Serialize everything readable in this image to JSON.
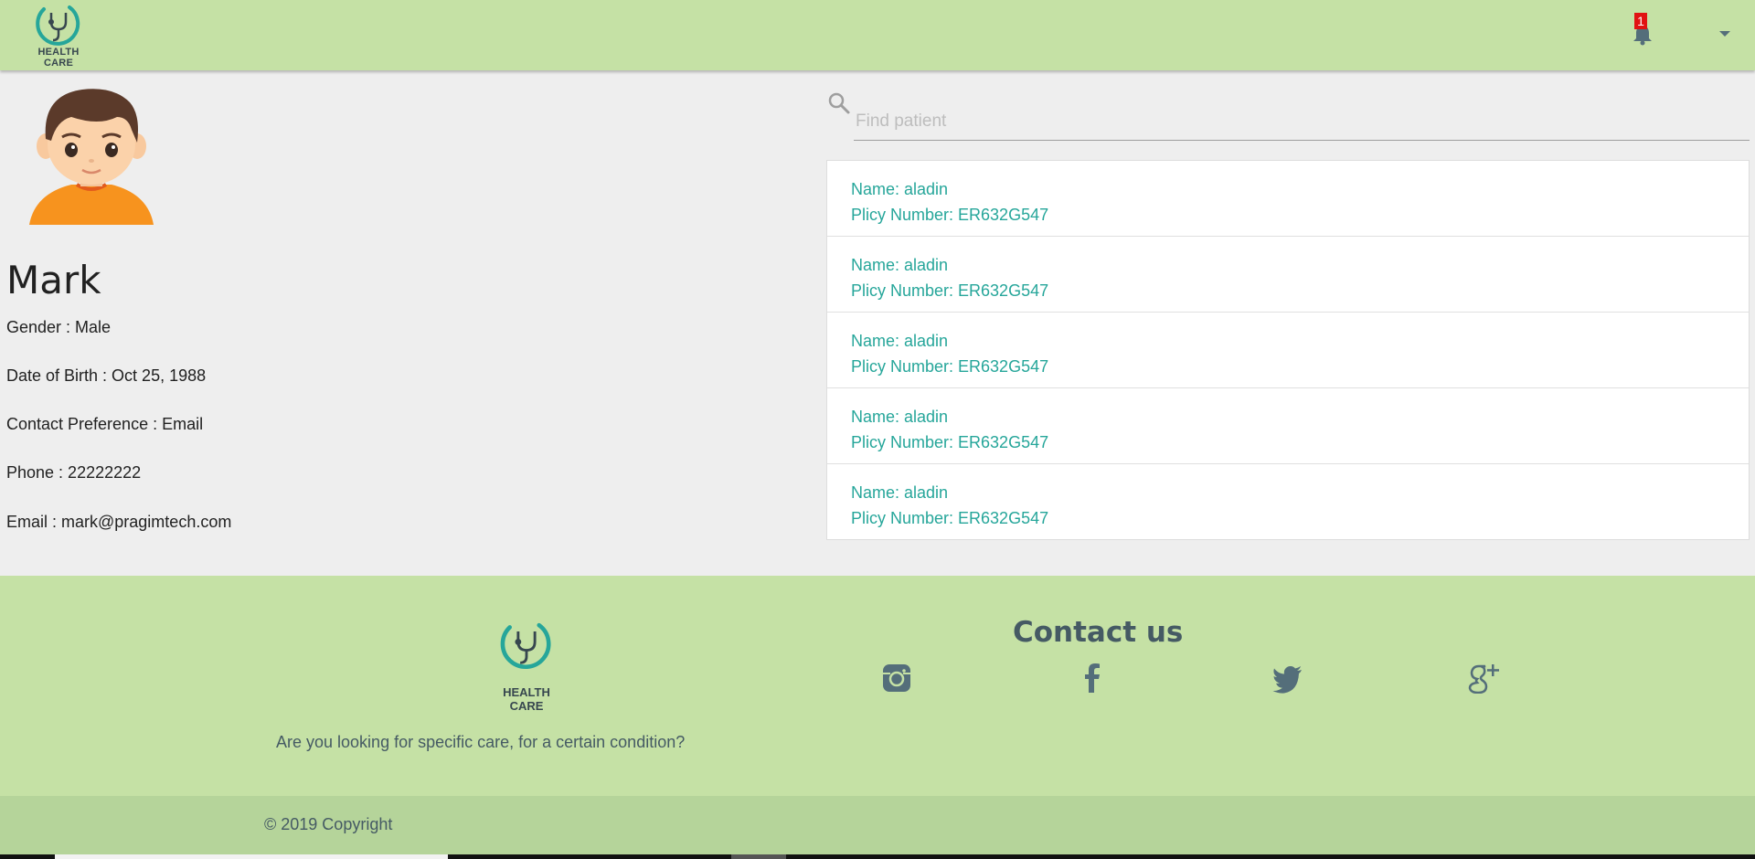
{
  "header": {
    "brand_name": "HEALTH CARE",
    "notification_count": "1"
  },
  "profile": {
    "name": "Mark",
    "gender": "Gender : Male",
    "dob": "Date of Birth : Oct 25, 1988",
    "contact_preference": "Contact Preference : Email",
    "phone": "Phone : 22222222",
    "email": "Email : mark@pragimtech.com"
  },
  "search": {
    "placeholder": "Find patient"
  },
  "patients": [
    {
      "name": "Name: aladin",
      "policy": "Plicy Number: ER632G547"
    },
    {
      "name": "Name: aladin",
      "policy": "Plicy Number: ER632G547"
    },
    {
      "name": "Name: aladin",
      "policy": "Plicy Number: ER632G547"
    },
    {
      "name": "Name: aladin",
      "policy": "Plicy Number: ER632G547"
    },
    {
      "name": "Name: aladin",
      "policy": "Plicy Number: ER632G547"
    }
  ],
  "footer": {
    "brand_name": "HEALTH CARE",
    "tagline": "Are you looking for specific care, for a certain condition?",
    "contact_title": "Contact us",
    "social_icons": [
      "instagram-icon",
      "facebook-icon",
      "twitter-icon",
      "google-plus-icon"
    ],
    "copyright": "© 2019 Copyright"
  },
  "colors": {
    "header_bg": "#c5e1a5",
    "footer_bg": "#c5e1a5",
    "copyright_bg": "#b5d49a",
    "accent_teal": "#26a69a",
    "badge_red": "#e11313",
    "icon_slate": "#546e7a"
  }
}
